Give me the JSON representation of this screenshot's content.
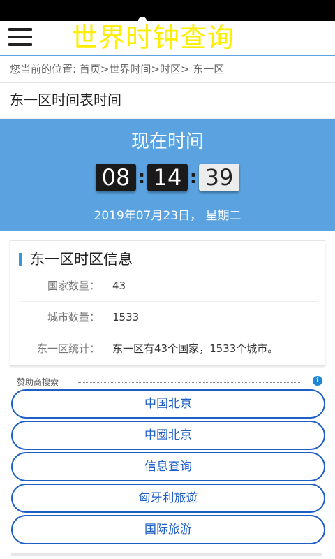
{
  "app": {
    "title": "世界时钟查询"
  },
  "breadcrumb": {
    "text": "您当前的位置: 首页>世界时间>时区> 东一区"
  },
  "page": {
    "title": "东一区时间表时间"
  },
  "clock": {
    "heading": "现在时间",
    "hours": "08",
    "minutes": "14",
    "seconds": "39",
    "separator": ":",
    "date": "2019年07月23日， 星期二"
  },
  "info": {
    "title": "东一区时区信息",
    "rows": [
      {
        "label": "国家数量：",
        "value": "43"
      },
      {
        "label": "城市数量：",
        "value": "1533"
      },
      {
        "label": "东一区统计：",
        "value": "东一区有43个国家，1533个城市。"
      }
    ]
  },
  "sponsor": {
    "label": "赞助商搜索",
    "info_icon": "i",
    "links": [
      "中国北京",
      "中國北京",
      "信息查询",
      "匈牙利旅遊",
      "国际旅游"
    ]
  },
  "colors": {
    "accent": "#5aa3e0",
    "title": "#ffee00",
    "link": "#1e5fc6"
  }
}
